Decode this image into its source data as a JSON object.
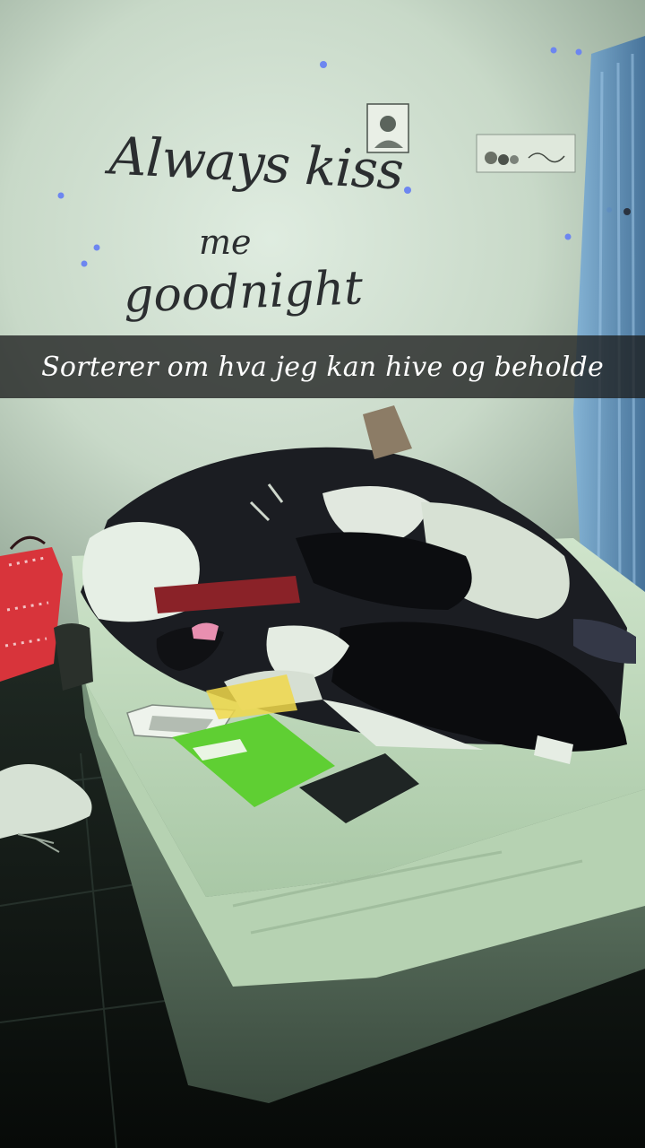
{
  "photo": {
    "wall_decal": {
      "line1": "Always kiss",
      "line2": "me",
      "line3": "goodnight"
    },
    "colors": {
      "wall": "#d4e3d0",
      "mattress": "#d8e9d2",
      "floor": "#0f1512",
      "notebook_green": "#5fcf33",
      "bag_red": "#d8343b"
    }
  },
  "overlay": {
    "caption": "Sorterer om hva jeg kan hive og beholde"
  }
}
